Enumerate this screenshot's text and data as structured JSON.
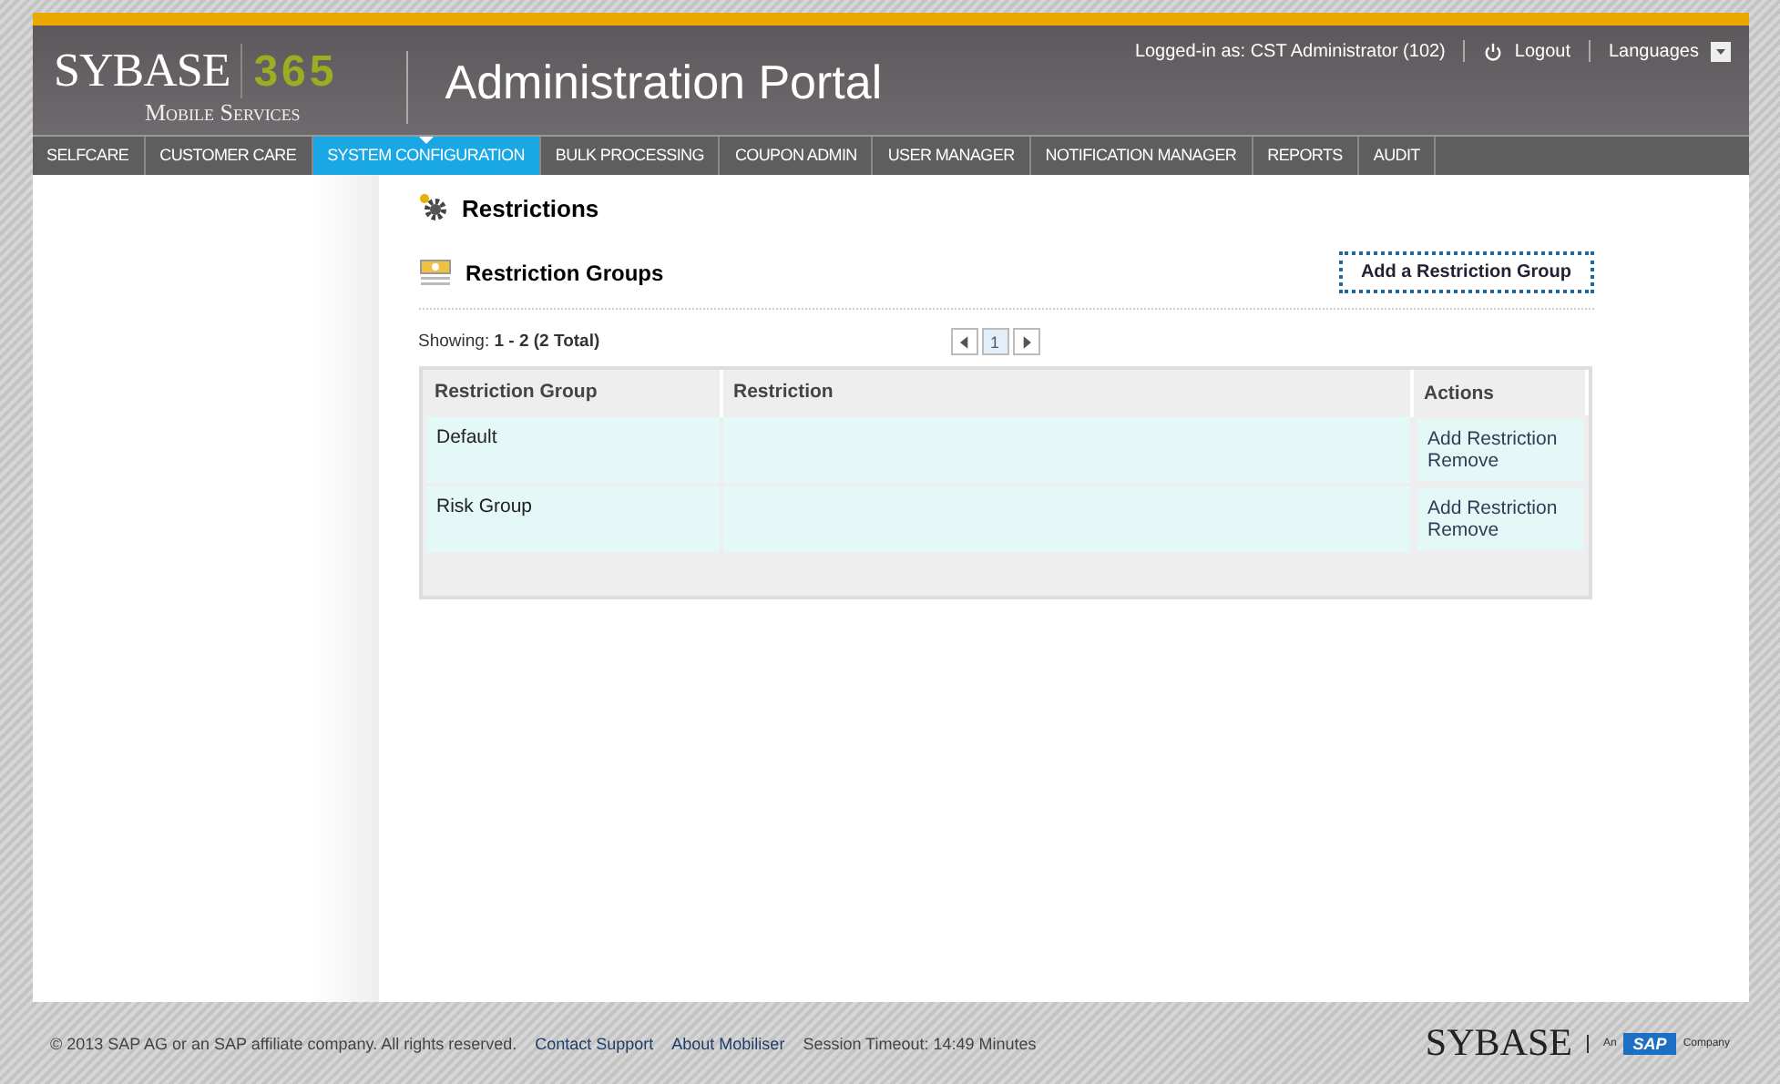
{
  "header": {
    "logo": {
      "brand": "SYBASE",
      "number": "365",
      "tagline": "Mobile Services"
    },
    "title": "Administration Portal",
    "user": "Logged-in as: CST Administrator (102)",
    "logout": "Logout",
    "languages": "Languages"
  },
  "nav": [
    {
      "label": "SELFCARE",
      "selected": false
    },
    {
      "label": "CUSTOMER CARE",
      "selected": false
    },
    {
      "label": "SYSTEM CONFIGURATION",
      "selected": true
    },
    {
      "label": "BULK PROCESSING",
      "selected": false
    },
    {
      "label": "COUPON ADMIN",
      "selected": false
    },
    {
      "label": "USER MANAGER",
      "selected": false
    },
    {
      "label": "NOTIFICATION MANAGER",
      "selected": false
    },
    {
      "label": "REPORTS",
      "selected": false
    },
    {
      "label": "AUDIT",
      "selected": false
    }
  ],
  "page_title": "Restrictions",
  "section": {
    "title": "Restriction Groups",
    "add_button": "Add a Restriction Group"
  },
  "showing": {
    "label": "Showing:",
    "range": "1 - 2 (2 Total)"
  },
  "pager": {
    "page": "1"
  },
  "table": {
    "columns": [
      "Restriction Group",
      "Restriction",
      "Actions"
    ],
    "rows": [
      {
        "group": "Default",
        "restriction": "",
        "actions": [
          "Add Restriction",
          "Remove"
        ]
      },
      {
        "group": "Risk Group",
        "restriction": "",
        "actions": [
          "Add Restriction",
          "Remove"
        ]
      }
    ]
  },
  "footer": {
    "copyright": "© 2013 SAP AG or an SAP affiliate company. All rights reserved.",
    "links": [
      "Contact Support",
      "About Mobiliser"
    ],
    "session": "Session Timeout: 14:49 Minutes",
    "logo": {
      "brand": "SYBASE",
      "prefix": "An",
      "sap": "SAP",
      "suffix": "Company"
    }
  }
}
